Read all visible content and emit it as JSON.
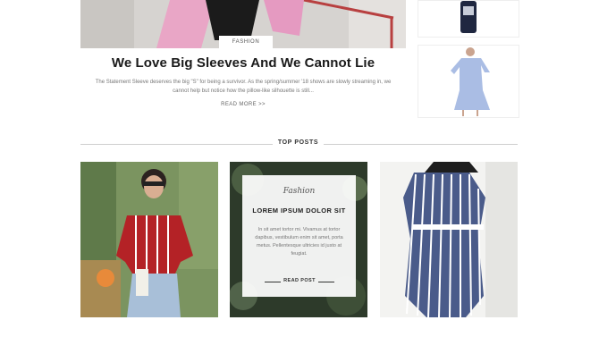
{
  "featured_post": {
    "category": "FASHION",
    "title": "We Love Big Sleeves And We Cannot Lie",
    "excerpt_line1": "The Statement Sleeve deserves the big \"S\" for being a survivor. As the spring/summer '18 shows are slowly streaming in, we",
    "excerpt_line2": "cannot help but notice how the pillow-like silhouette is still...",
    "read_more": "READ MORE >>"
  },
  "top_posts": {
    "heading": "TOP POSTS",
    "overlay": {
      "category": "Fashion",
      "title": "LOREM IPSUM DOLOR SIT",
      "text": "In sit amet tortor mi. Vivamus at tortor dapibus, vestibulum enim sit amet, porta metus. Pellentesque ultricies id justo at feugiat.",
      "read_post": "READ POST"
    }
  },
  "colors": {
    "heading": "#1a1a1a",
    "body_text": "#777777",
    "divider": "#cfcfcf"
  }
}
